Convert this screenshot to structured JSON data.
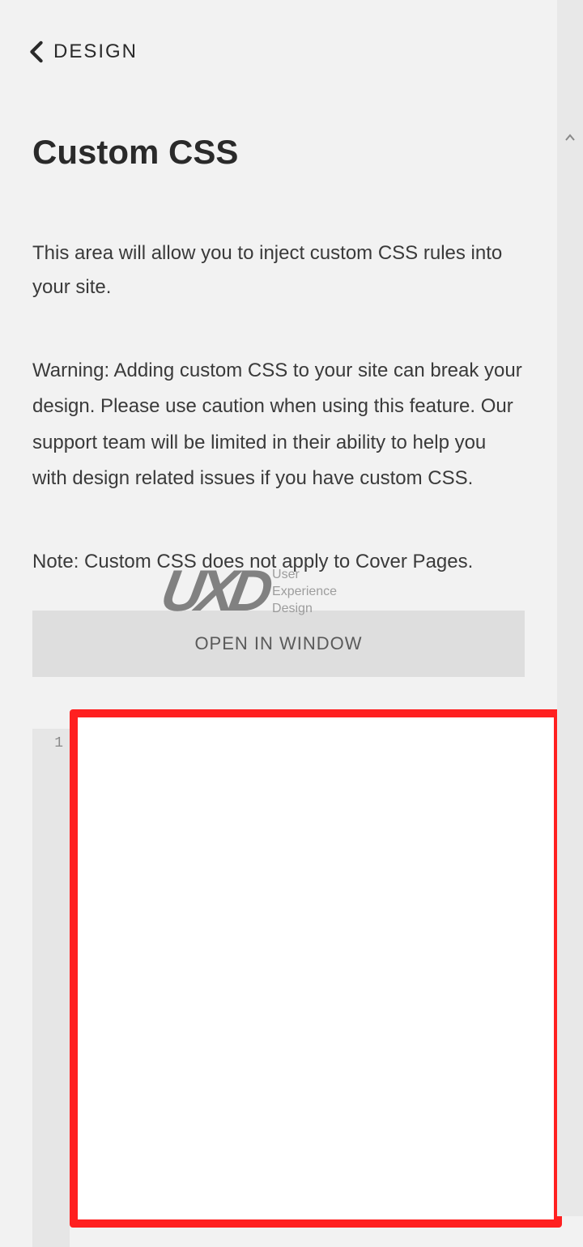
{
  "nav": {
    "back_label": "DESIGN"
  },
  "page": {
    "title": "Custom CSS",
    "description": "This area will allow you to inject custom CSS rules into your site.",
    "warning": "Warning: Adding custom CSS to your site can break your design. Please use caution when using this feature. Our support team will be limited in their ability to help you with design related issues if you have custom CSS.",
    "note": "Note: Custom CSS does not apply to Cover Pages.",
    "open_button_label": "OPEN IN WINDOW"
  },
  "editor": {
    "line_number": "1",
    "content": ""
  },
  "watermark": {
    "logo": "UXD",
    "line1": "User",
    "line2": "Experience",
    "line3": "Design"
  }
}
